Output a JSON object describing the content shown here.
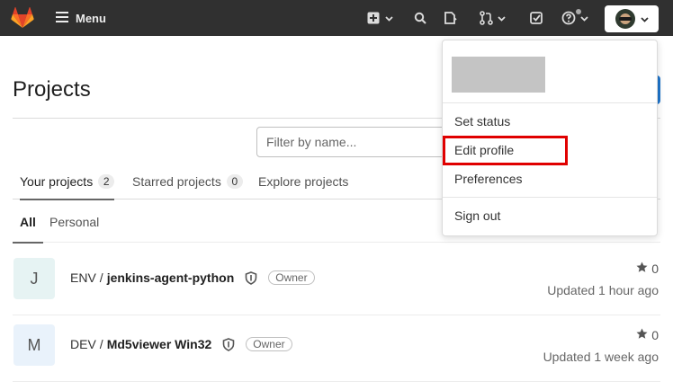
{
  "navbar": {
    "menu_label": "Menu"
  },
  "page": {
    "title": "Projects"
  },
  "filter": {
    "placeholder": "Filter by name..."
  },
  "tabs": [
    {
      "label": "Your projects",
      "count": "2"
    },
    {
      "label": "Starred projects",
      "count": "0"
    },
    {
      "label": "Explore projects"
    }
  ],
  "subtabs": [
    {
      "label": "All"
    },
    {
      "label": "Personal"
    }
  ],
  "projects": [
    {
      "initial": "J",
      "namespace": "ENV",
      "name": "jenkins-agent-python",
      "role": "Owner",
      "stars": "0",
      "updated": "Updated 1 hour ago",
      "avatar_color": "#e6f3f3"
    },
    {
      "initial": "M",
      "namespace": "DEV",
      "name": "Md5viewer Win32",
      "role": "Owner",
      "stars": "0",
      "updated": "Updated 1 week ago",
      "avatar_color": "#e9f2fb"
    }
  ],
  "user_menu": {
    "items": [
      "Set status",
      "Edit profile",
      "Preferences",
      "Sign out"
    ]
  },
  "colors": {
    "navbar": "#303030",
    "highlight": "#e00000",
    "brand_orange": "#fc6d26"
  }
}
